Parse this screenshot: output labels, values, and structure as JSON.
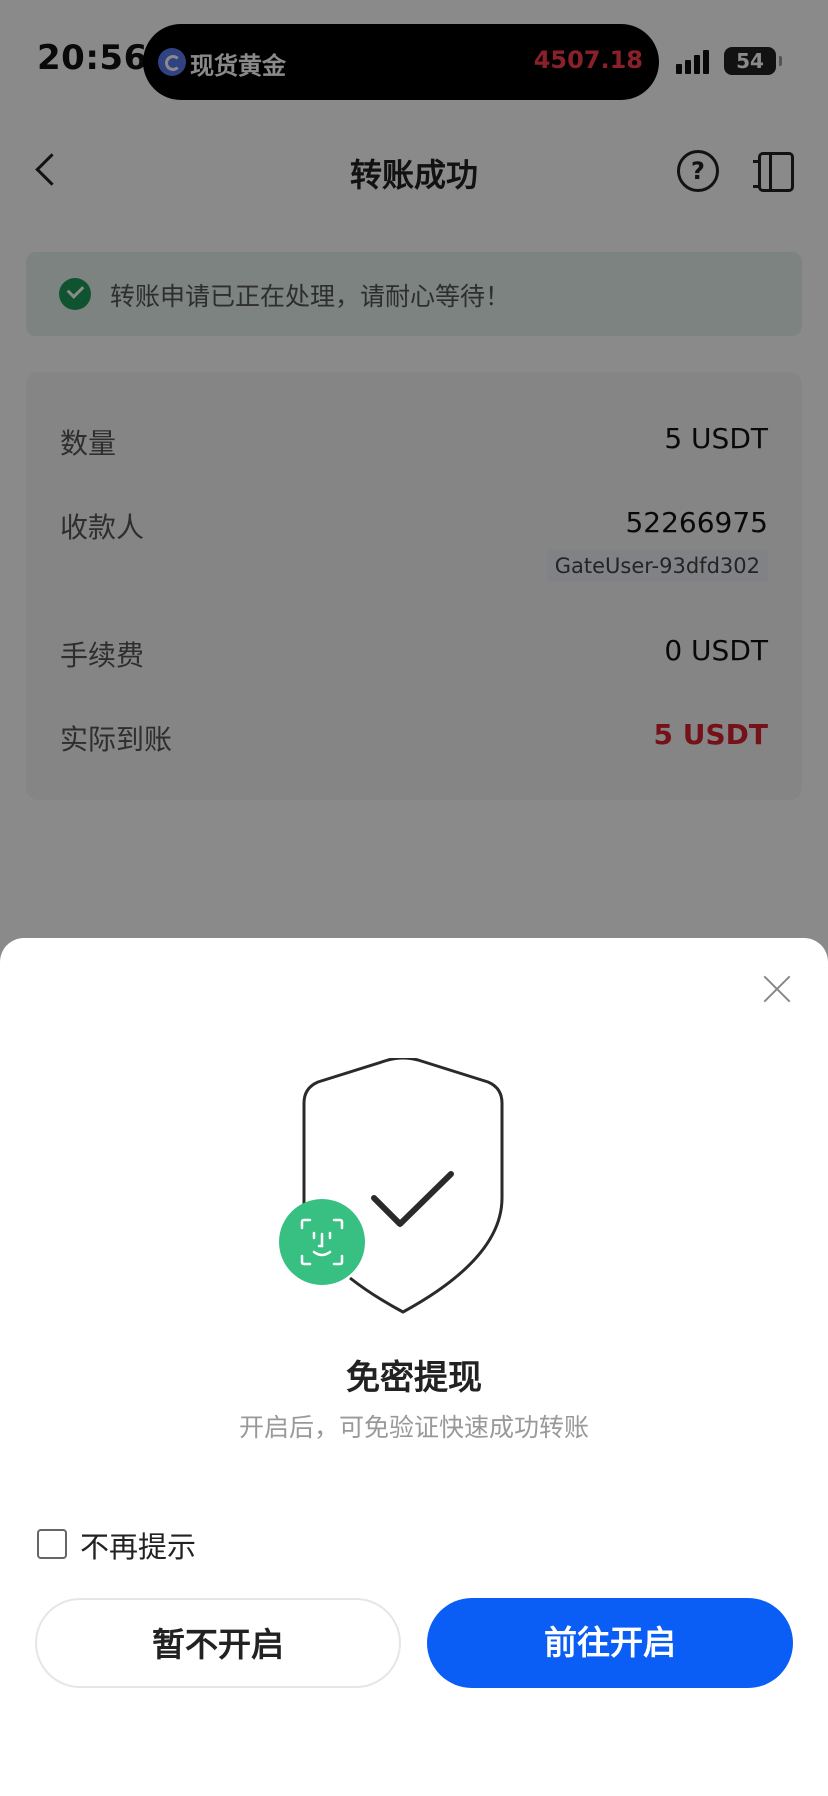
{
  "status_bar": {
    "time": "20:56",
    "island_title": "现货黄金",
    "island_price": "4507.18",
    "battery": "54"
  },
  "nav": {
    "title": "转账成功",
    "help_glyph": "?"
  },
  "notice": {
    "text": "转账申请已正在处理，请耐心等待！"
  },
  "details": {
    "amount_label": "数量",
    "amount_value": "5 USDT",
    "payee_label": "收款人",
    "payee_id": "52266975",
    "payee_name": "GateUser-93dfd302",
    "fee_label": "手续费",
    "fee_value": "0 USDT",
    "received_label": "实际到账",
    "received_value": "5 USDT"
  },
  "sheet": {
    "title": "免密提现",
    "subtitle": "开启后，可免验证快速成功转账",
    "checkbox_label": "不再提示",
    "cancel_label": "暂不开启",
    "confirm_label": "前往开启"
  },
  "colors": {
    "accent": "#0a5df5",
    "success": "#1f9a5a",
    "received": "#d8222f",
    "price": "#ff3b4e"
  },
  "icons": [
    "back-icon",
    "help-icon",
    "record-icon",
    "check-circle-icon",
    "close-icon",
    "shield-check-icon",
    "face-id-icon"
  ]
}
